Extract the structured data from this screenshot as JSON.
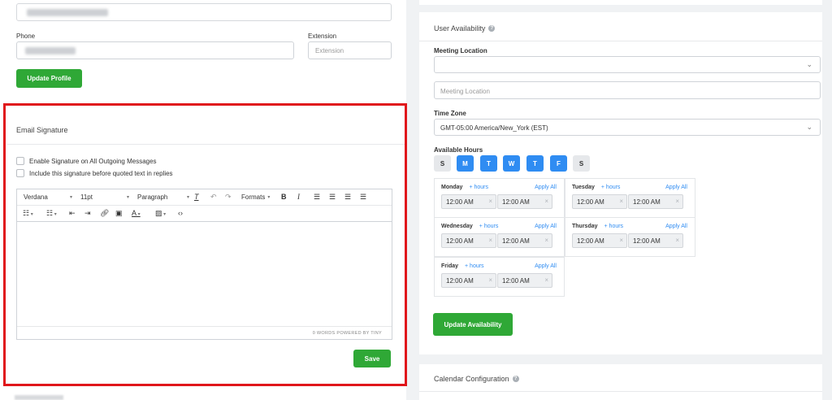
{
  "profile": {
    "phone_label": "Phone",
    "extension_label": "Extension",
    "extension_placeholder": "Extension",
    "update_button": "Update Profile"
  },
  "signature": {
    "title": "Email Signature",
    "checkbox_enable": "Enable Signature on All Outgoing Messages",
    "checkbox_include": "Include this signature before quoted text in replies",
    "editor": {
      "font_family": "Verdana",
      "font_size": "11pt",
      "block_format": "Paragraph",
      "formats_label": "Formats",
      "status_text": "0 WORDS POWERED BY TINY"
    },
    "save_button": "Save"
  },
  "availability": {
    "title": "User Availability",
    "meeting_location_label": "Meeting Location",
    "meeting_location_select_value": "",
    "meeting_location_placeholder": "Meeting Location",
    "timezone_label": "Time Zone",
    "timezone_value": "GMT-05:00 America/New_York (EST)",
    "available_hours_label": "Available Hours",
    "days": [
      {
        "label": "S",
        "active": false
      },
      {
        "label": "M",
        "active": true
      },
      {
        "label": "T",
        "active": true
      },
      {
        "label": "W",
        "active": true
      },
      {
        "label": "T",
        "active": true
      },
      {
        "label": "F",
        "active": true
      },
      {
        "label": "S",
        "active": false
      }
    ],
    "add_hours_label": "+ hours",
    "apply_all_label": "Apply All",
    "schedule": [
      {
        "day": "Monday",
        "start": "12:00 AM",
        "end": "12:00 AM"
      },
      {
        "day": "Tuesday",
        "start": "12:00 AM",
        "end": "12:00 AM"
      },
      {
        "day": "Wednesday",
        "start": "12:00 AM",
        "end": "12:00 AM"
      },
      {
        "day": "Thursday",
        "start": "12:00 AM",
        "end": "12:00 AM"
      },
      {
        "day": "Friday",
        "start": "12:00 AM",
        "end": "12:00 AM"
      }
    ],
    "update_button": "Update Availability"
  },
  "calendar": {
    "title": "Calendar Configuration"
  },
  "colors": {
    "accent_green": "#2fa836",
    "accent_blue": "#2f8cf2",
    "highlight_red": "#e0161b"
  }
}
